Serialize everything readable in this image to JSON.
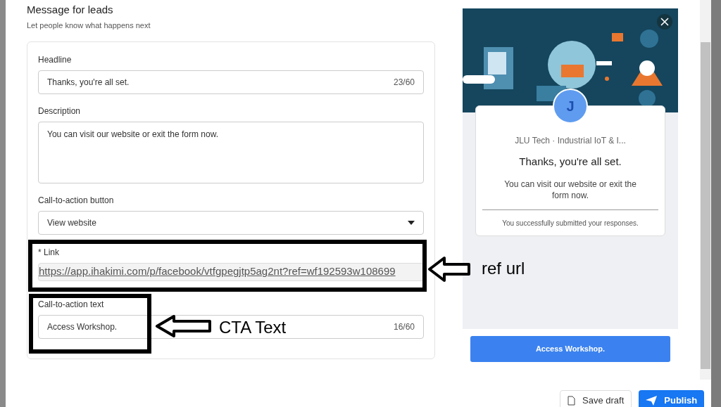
{
  "section": {
    "title": "Message for leads",
    "subtitle": "Let people know what happens next"
  },
  "fields": [
    {
      "kind": "text",
      "label": "Headline",
      "value": "Thanks, you're all set.",
      "counter": "23/60"
    },
    {
      "kind": "textarea",
      "label": "Description",
      "value": "You can visit our website or exit the form now."
    },
    {
      "kind": "select",
      "label": "Call-to-action button",
      "value": "View website"
    },
    {
      "kind": "link",
      "label": "* Link",
      "value": "https://app.ihakimi.com/p/facebook/vtfgpegjtp5ag2nt?ref=wf192593w108699"
    },
    {
      "kind": "text",
      "label": "Call-to-action text",
      "value": "Access Workshop.",
      "counter": "16/60"
    }
  ],
  "preview": {
    "avatar": "J",
    "company": "JLU Tech · Industrial IoT & I...",
    "headline": "Thanks, you're all set.",
    "description": "You can visit our website or exit the form now.",
    "note": "You successfully submitted your responses.",
    "cta": "Access Workshop."
  },
  "annotations": [
    {
      "label": "ref url"
    },
    {
      "label": "CTA Text"
    }
  ],
  "buttons": [
    {
      "kind": "secondary",
      "label": "Save draft"
    },
    {
      "kind": "primary",
      "label": "Publish"
    }
  ]
}
